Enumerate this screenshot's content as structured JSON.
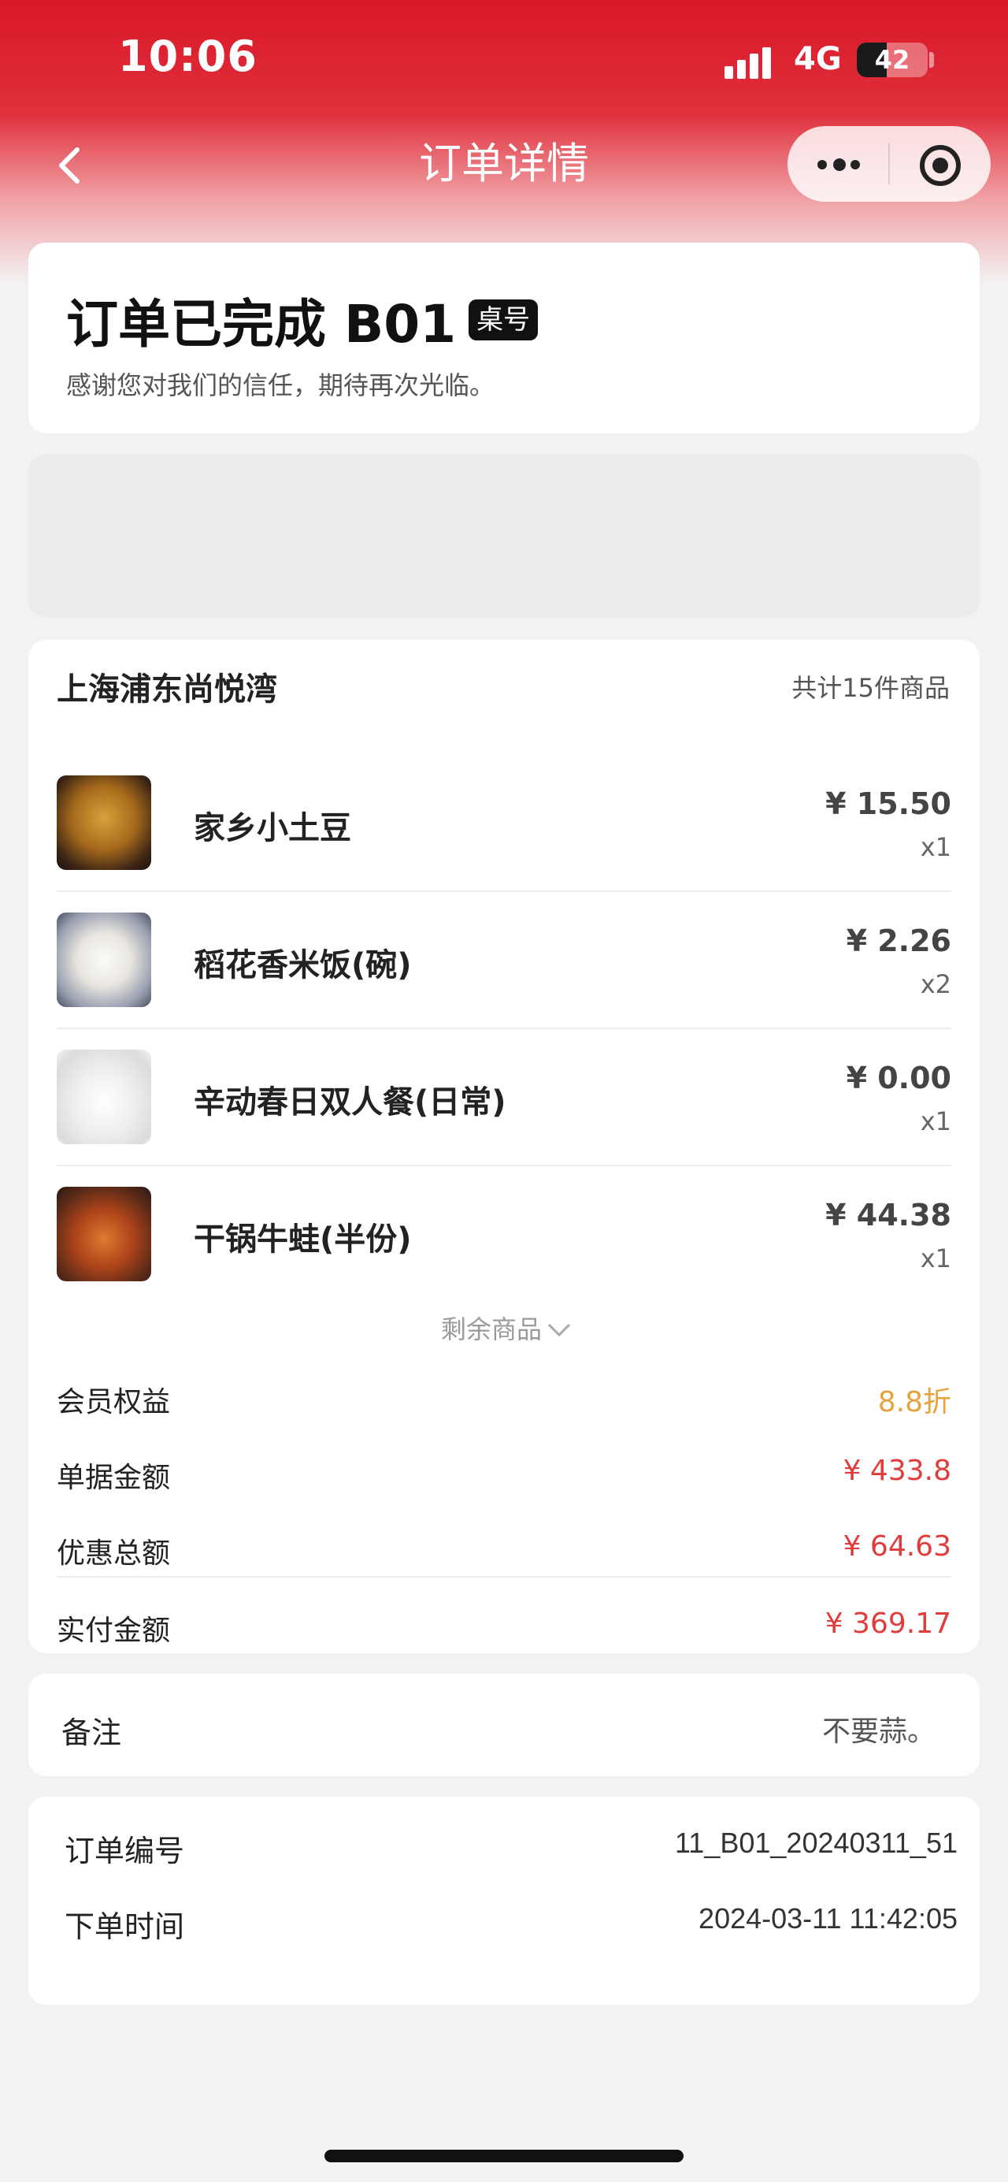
{
  "status_bar": {
    "time": "10:06",
    "network": "4G",
    "battery_level": 42,
    "battery_text": "42"
  },
  "nav": {
    "title": "订单详情",
    "icons": {
      "back": "chevron-left-icon",
      "more": "more-dots-icon",
      "close": "target-icon"
    }
  },
  "order_status": {
    "title": "订单已完成 B01",
    "table_badge": "桌号",
    "subtitle": "感谢您对我们的信任，期待再次光临。"
  },
  "order": {
    "store_name": "上海浦东尚悦湾",
    "item_count": "共计15件商品",
    "items": [
      {
        "name": "家乡小土豆",
        "price": "¥ 15.50",
        "qty": "x1"
      },
      {
        "name": "稻花香米饭(碗)",
        "price": "¥ 2.26",
        "qty": "x2"
      },
      {
        "name": "辛动春日双人餐(日常)",
        "price": "¥ 0.00",
        "qty": "x1"
      },
      {
        "name": "干锅牛蛙(半份)",
        "price": "¥ 44.38",
        "qty": "x1"
      }
    ],
    "more_items": "剩余商品",
    "summary": [
      {
        "label": "会员权益",
        "value": "8.8折",
        "color": "#e6a23c"
      },
      {
        "label": "单据金额",
        "value": "¥ 433.8",
        "color": "#e23b3b"
      },
      {
        "label": "优惠总额",
        "value": "¥ 64.63",
        "color": "#e23b3b"
      },
      {
        "label": "实付金额",
        "value": "¥ 369.17",
        "color": "#e23b3b"
      }
    ]
  },
  "note": {
    "label": "备注",
    "value": "不要蒜。"
  },
  "info": {
    "order_no_label": "订单编号",
    "order_no": "11_B01_20240311_51",
    "order_time_label": "下单时间",
    "order_time": "2024-03-11 11:42:05"
  },
  "colors": {
    "brand_red": "#d91728",
    "price_red": "#e23b3b",
    "discount_orange": "#e6a23c"
  }
}
